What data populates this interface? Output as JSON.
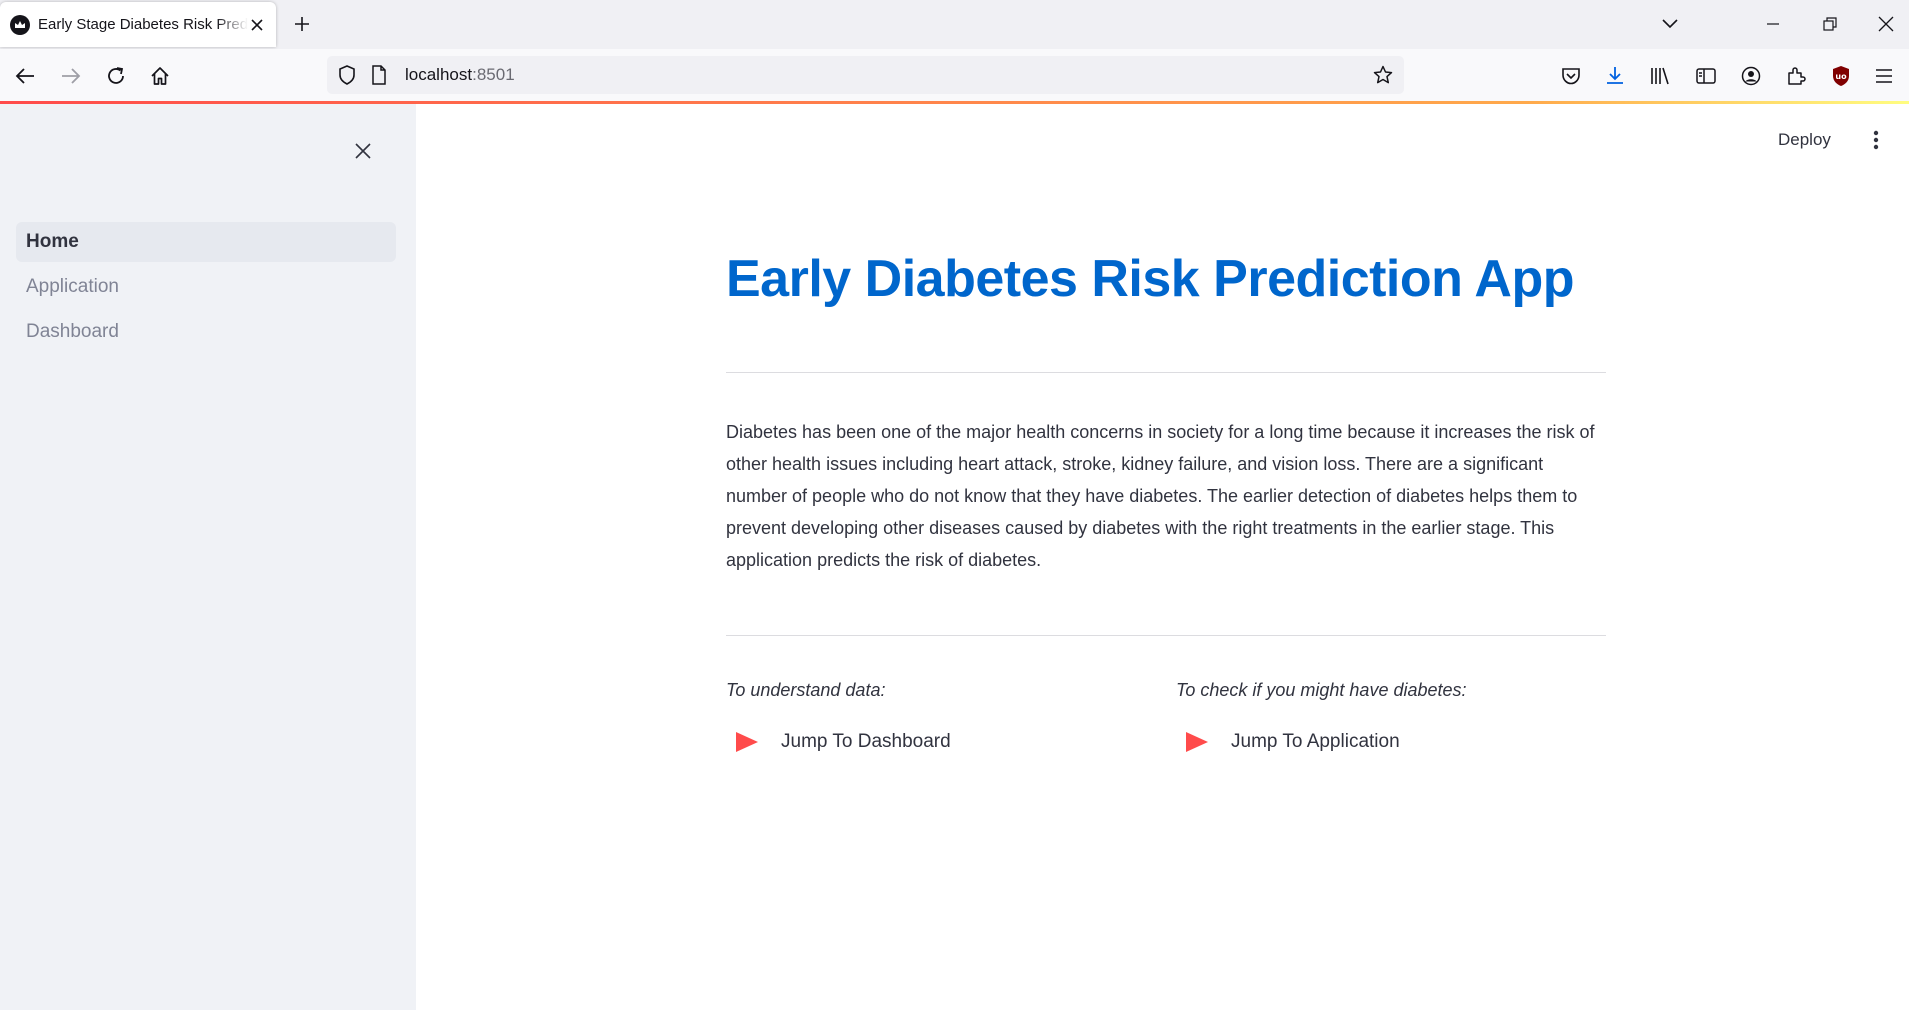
{
  "browser": {
    "tab_title": "Early Stage Diabetes Risk Prediction",
    "url_host": "localhost",
    "url_port": ":8501"
  },
  "header": {
    "deploy_label": "Deploy"
  },
  "sidebar": {
    "items": [
      {
        "label": "Home",
        "active": true
      },
      {
        "label": "Application",
        "active": false
      },
      {
        "label": "Dashboard",
        "active": false
      }
    ]
  },
  "main": {
    "title": "Early Diabetes Risk Prediction App",
    "description": "Diabetes has been one of the major health concerns in society for a long time because it increases the risk of other health issues including heart attack, stroke, kidney failure, and vision loss. There are a significant number of people who do not know that they have diabetes. The earlier detection of diabetes helps them to prevent developing other diseases caused by diabetes with the right treatments in the earlier stage. This application predicts the risk of diabetes.",
    "columns": [
      {
        "label": "To understand data:",
        "link": "Jump To Dashboard"
      },
      {
        "label": "To check if you might have diabetes:",
        "link": "Jump To Application"
      }
    ]
  },
  "colors": {
    "title": "#0066cc",
    "accent": "#ff4b4b",
    "sidebar_bg": "#f0f2f6"
  }
}
